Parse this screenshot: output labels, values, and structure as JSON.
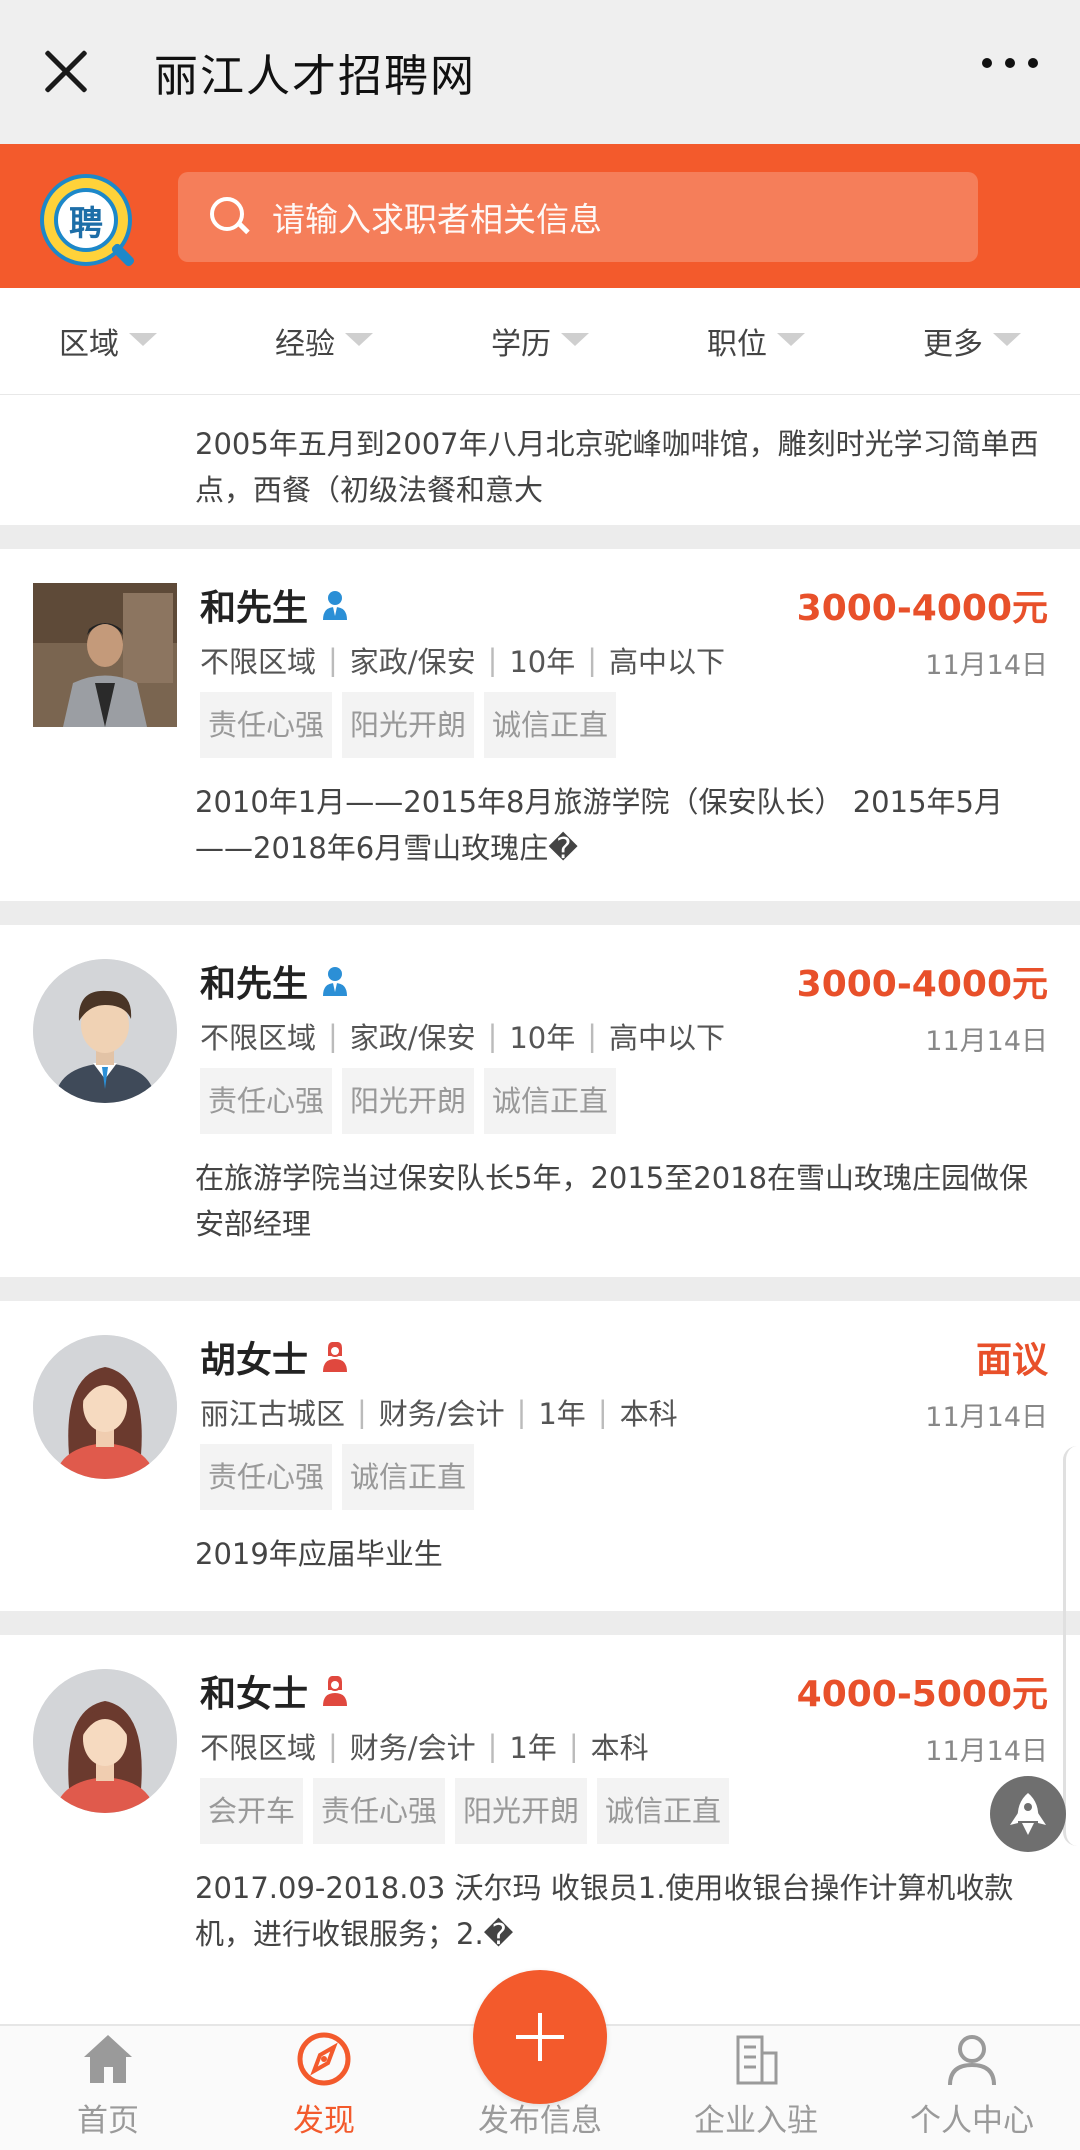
{
  "window": {
    "title": "丽江人才招聘网"
  },
  "header": {
    "logo_text": "聘",
    "search_placeholder": "请输入求职者相关信息"
  },
  "filters": [
    "区域",
    "经验",
    "学历",
    "职位",
    "更多"
  ],
  "first_snippet": "2005年五月到2007年八月北京驼峰咖啡馆，雕刻时光学习简单西点，西餐（初级法餐和意大",
  "cards": [
    {
      "name": "和先生",
      "gender": "male",
      "salary": "3000-4000元",
      "meta": [
        "不限区域",
        "家政/保安",
        "10年",
        "高中以下"
      ],
      "date": "11月14日",
      "tags": [
        "责任心强",
        "阳光开朗",
        "诚信正直"
      ],
      "snippet": "2010年1月——2015年8月旅游学院（保安队长） 2015年5月——2018年6月雪山玫瑰庄�",
      "avatar": "photo"
    },
    {
      "name": "和先生",
      "gender": "male",
      "salary": "3000-4000元",
      "meta": [
        "不限区域",
        "家政/保安",
        "10年",
        "高中以下"
      ],
      "date": "11月14日",
      "tags": [
        "责任心强",
        "阳光开朗",
        "诚信正直"
      ],
      "snippet": "在旅游学院当过保安队长5年，2015至2018在雪山玫瑰庄园做保安部经理",
      "avatar": "male-default"
    },
    {
      "name": "胡女士",
      "gender": "female",
      "salary": "面议",
      "meta": [
        "丽江古城区",
        "财务/会计",
        "1年",
        "本科"
      ],
      "date": "11月14日",
      "tags": [
        "责任心强",
        "诚信正直"
      ],
      "snippet": "2019年应届毕业生",
      "avatar": "female-default"
    },
    {
      "name": "和女士",
      "gender": "female",
      "salary": "4000-5000元",
      "meta": [
        "不限区域",
        "财务/会计",
        "1年",
        "本科"
      ],
      "date": "11月14日",
      "tags": [
        "会开车",
        "责任心强",
        "阳光开朗",
        "诚信正直"
      ],
      "snippet": "2017.09-2018.03 沃尔玛 收银员1.使用收银台操作计算机收款机，进行收银服务；2.�",
      "avatar": "female-default"
    }
  ],
  "nav": [
    {
      "label": "首页",
      "icon": "home-icon",
      "active": false
    },
    {
      "label": "发现",
      "icon": "discover-icon",
      "active": true
    },
    {
      "label": "发布信息",
      "icon": "plus-icon",
      "active": false
    },
    {
      "label": "企业入驻",
      "icon": "building-icon",
      "active": false
    },
    {
      "label": "个人中心",
      "icon": "user-icon",
      "active": false
    }
  ],
  "colors": {
    "brand": "#f35a2c",
    "salary": "#e8502a",
    "male": "#2b8fd6",
    "female": "#e0483e"
  }
}
